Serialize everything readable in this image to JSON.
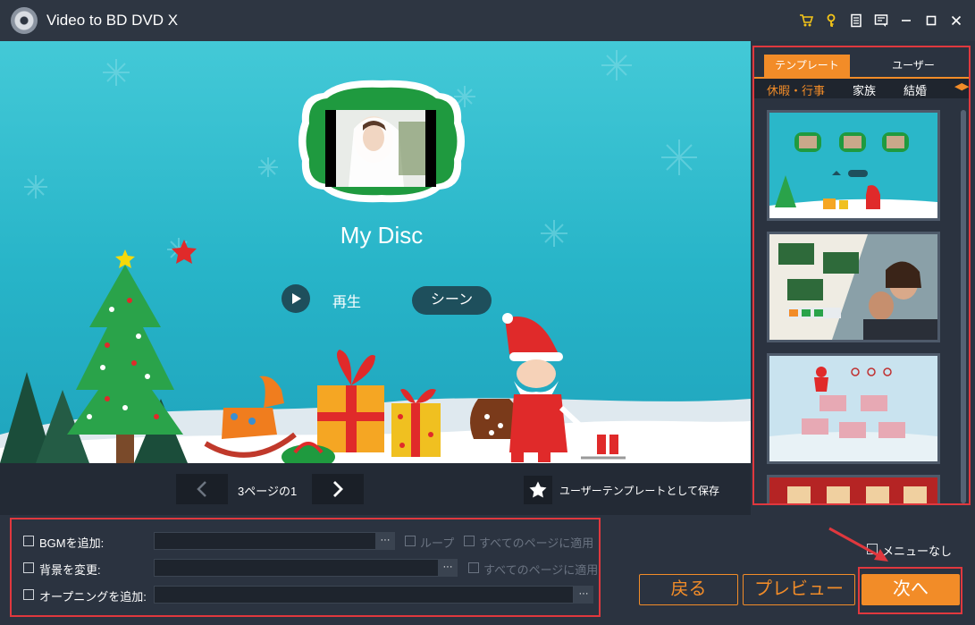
{
  "window": {
    "title": "Video to BD DVD X",
    "icons": [
      "cart-icon",
      "key-icon",
      "document-icon",
      "feedback-icon",
      "minimize-icon",
      "maximize-icon",
      "close-icon"
    ]
  },
  "preview": {
    "disc_title": "My Disc",
    "play_label": "再生",
    "scene_label": "シーン"
  },
  "pager": {
    "page_text": "3ページの1",
    "save_template_label": "ユーザーテンプレートとして保存"
  },
  "templates": {
    "tabs": [
      "テンプレート",
      "ユーザー"
    ],
    "active_tab": 0,
    "categories": [
      "休暇・行事",
      "家族",
      "結婚"
    ],
    "active_category": 0
  },
  "options": {
    "bgm": {
      "label": "BGMを追加:",
      "value": "",
      "browse": "···",
      "loop_label": "ループ",
      "apply_all_label": "すべてのページに適用"
    },
    "background": {
      "label": "背景を変更:",
      "value": "",
      "browse": "···",
      "apply_all_label": "すべてのページに適用"
    },
    "opening": {
      "label": "オープニングを追加:",
      "value": "",
      "browse": "···"
    }
  },
  "actions": {
    "no_menu_label": "メニューなし",
    "back_label": "戻る",
    "preview_label": "プレビュー",
    "next_label": "次へ"
  },
  "colors": {
    "accent": "#f28c28",
    "highlight": "#e0383e",
    "background": "#2b3340"
  }
}
